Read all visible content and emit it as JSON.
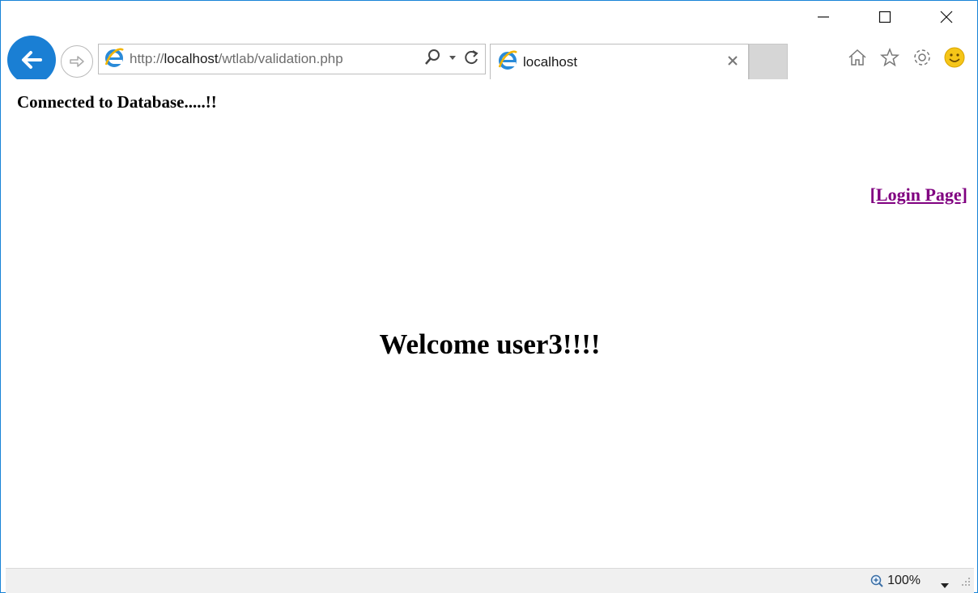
{
  "browser": {
    "address_bar": {
      "url_prefix": "http://",
      "url_host": "localhost",
      "url_path": "/wtlab/validation.php"
    },
    "tab": {
      "title": "localhost"
    },
    "colors": {
      "accent": "#1a7fd4",
      "window_border": "#1883d7"
    },
    "icons": [
      "back-arrow-icon",
      "forward-arrow-icon",
      "ie-logo-icon",
      "search-icon",
      "dropdown-icon",
      "refresh-icon",
      "close-icon",
      "home-icon",
      "favorites-star-icon",
      "settings-gear-icon",
      "feedback-smiley-icon",
      "zoom-icon",
      "resize-grip-icon"
    ]
  },
  "page": {
    "connected_text": "Connected to Database.....!!",
    "login_link": "[Login Page]",
    "welcome_text": "Welcome user3!!!!",
    "link_color": "#800080"
  },
  "statusbar": {
    "zoom_level": "100%"
  }
}
